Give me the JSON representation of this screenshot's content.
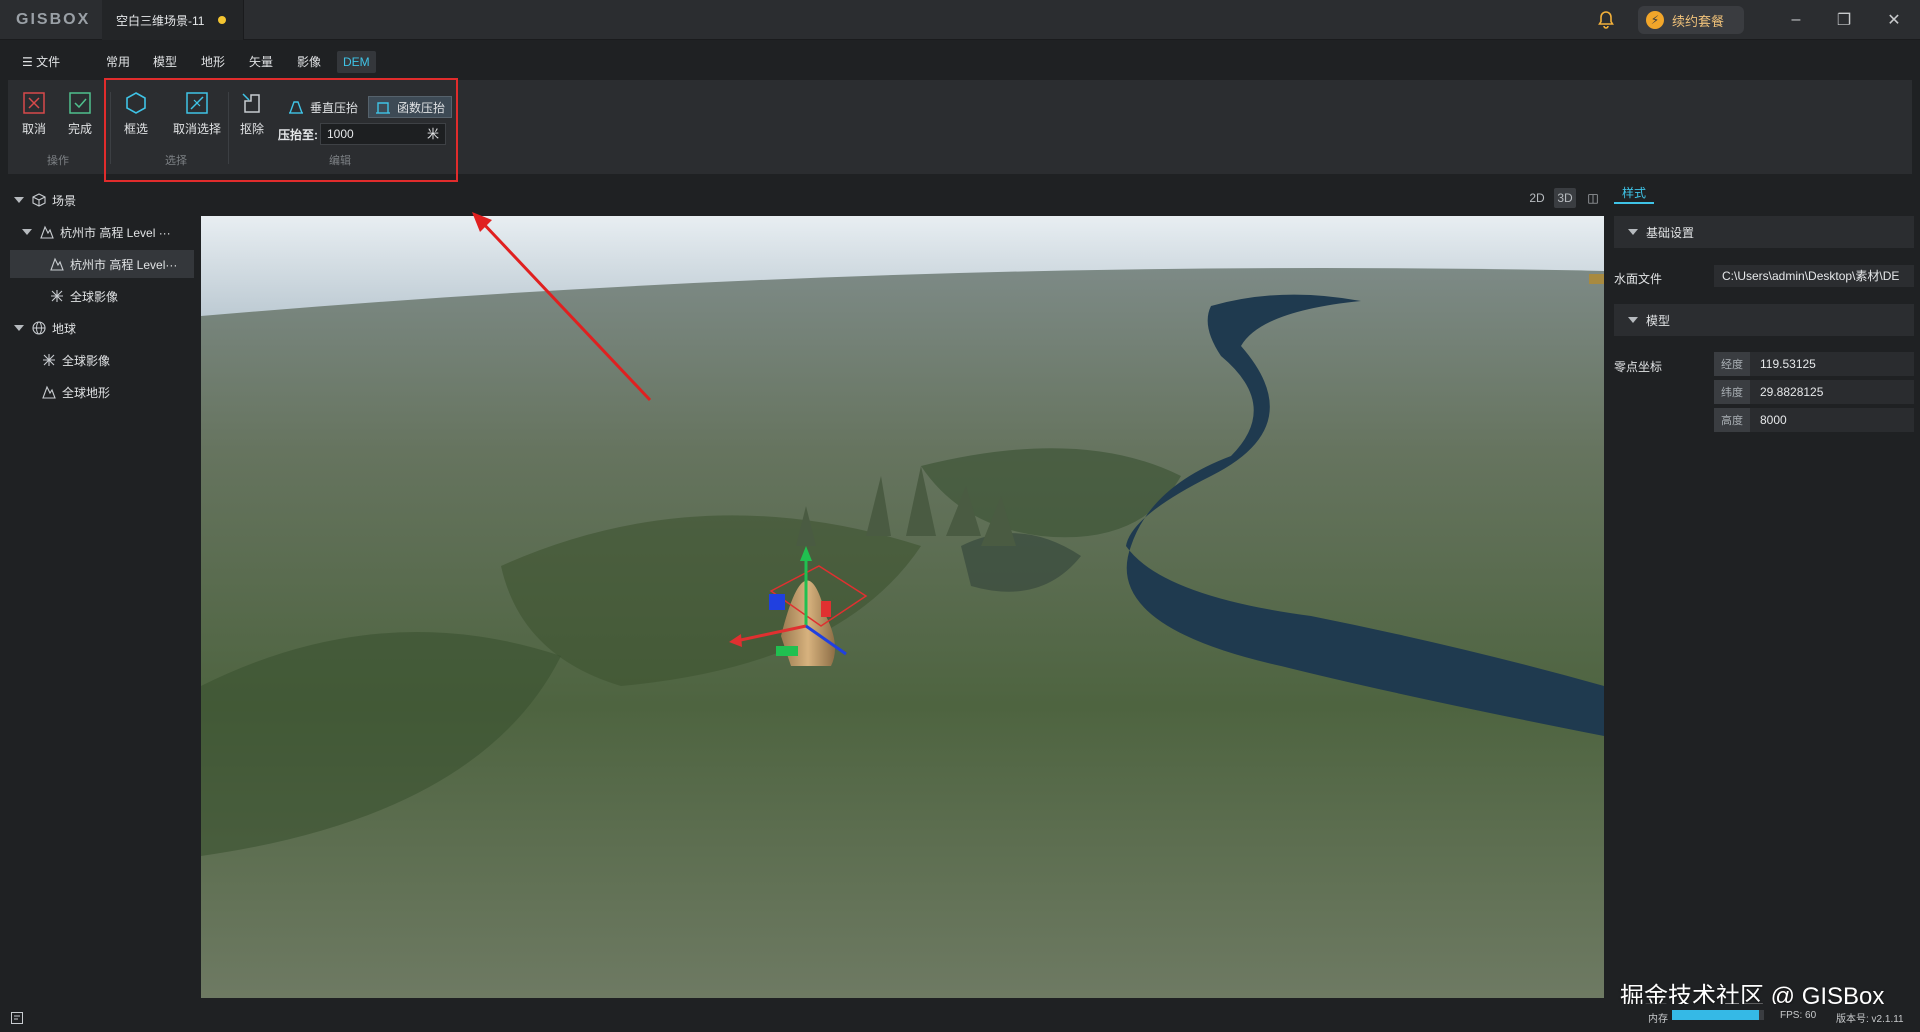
{
  "app": {
    "logo": "GISBOX",
    "doc_title": "空白三维场景-11",
    "renew_label": "续约套餐"
  },
  "menu": {
    "items": [
      "文件",
      "常用",
      "模型",
      "地形",
      "矢量",
      "影像",
      "DEM"
    ],
    "active": "DEM"
  },
  "ribbon": {
    "cancel": "取消",
    "done": "完成",
    "group_operate": "操作",
    "box_select": "框选",
    "cancel_select": "取消选择",
    "group_select": "选择",
    "remove": "抠除",
    "vertical_flatten": "垂直压抬",
    "function_flatten": "函数压抬",
    "flatten_to_label": "压抬至:",
    "flatten_to_value": "1000",
    "flatten_unit": "米",
    "group_edit": "编辑"
  },
  "tree": {
    "scene": "场景",
    "level_group": "杭州市 高程 Level ···",
    "level_item": "杭州市 高程 Level···",
    "global_image_1": "全球影像",
    "earth": "地球",
    "global_image_2": "全球影像",
    "global_terrain": "全球地形"
  },
  "view_modes": [
    "2D",
    "3D"
  ],
  "panel": {
    "tab": "样式",
    "basic_section": "基础设置",
    "water_file_label": "水面文件",
    "water_file_value": "C:\\Users\\admin\\Desktop\\素材\\DE",
    "model_section": "模型",
    "origin_label": "零点坐标",
    "lon_key": "经度",
    "lon_value": "119.53125",
    "lat_key": "纬度",
    "lat_value": "29.8828125",
    "alt_key": "高度",
    "alt_value": "8000"
  },
  "status": {
    "watermark": "掘金技术社区 @ GISBox",
    "memory_label": "内存",
    "memory_fill": 0.95,
    "fps": "FPS: 60",
    "version": "版本号: v2.1.11"
  },
  "colors": {
    "accent": "#3fc3e6",
    "highlight_box": "#e12c2c",
    "renew_text": "#f0c27a"
  }
}
